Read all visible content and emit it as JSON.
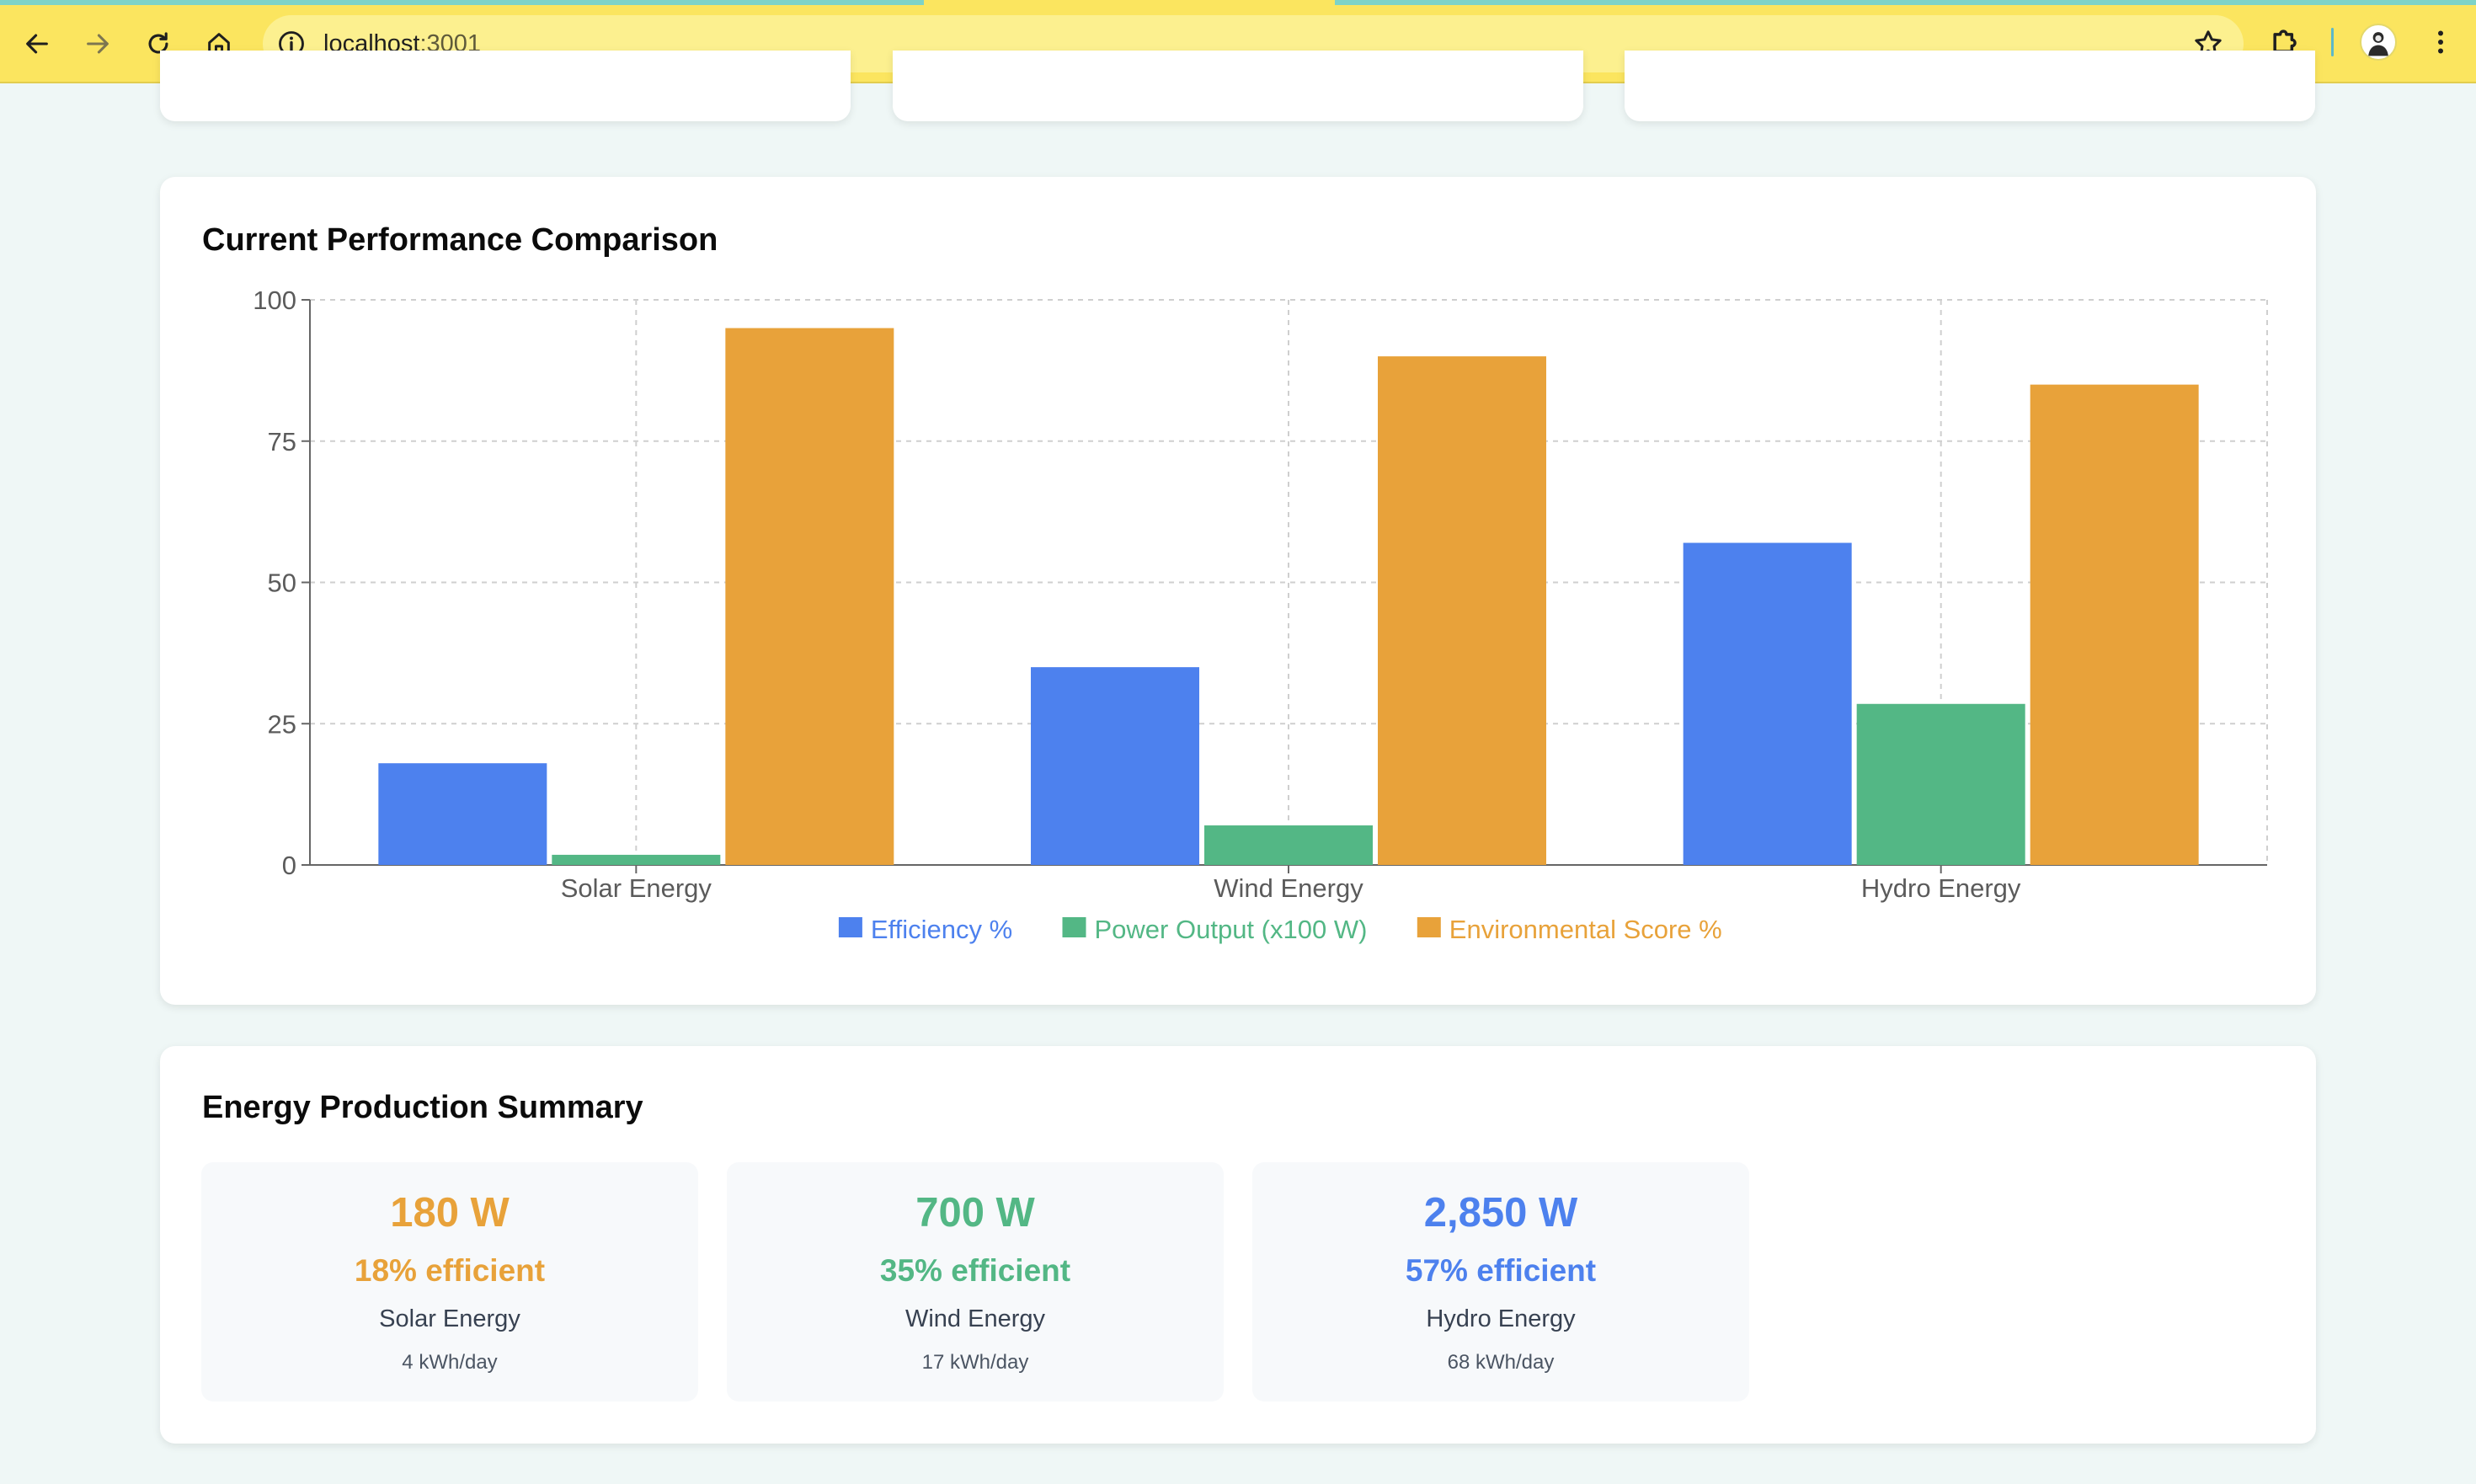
{
  "browser": {
    "url_host": "localhost",
    "url_port": ":3001"
  },
  "comparison": {
    "title": "Current Performance Comparison"
  },
  "chart_data": {
    "type": "bar",
    "categories": [
      "Solar Energy",
      "Wind Energy",
      "Hydro Energy"
    ],
    "series": [
      {
        "name": "Efficiency %",
        "values": [
          18,
          35,
          57
        ],
        "color": "#4d81ee"
      },
      {
        "name": "Power Output (x100 W)",
        "values": [
          1.8,
          7,
          28.5
        ],
        "color": "#53b785"
      },
      {
        "name": "Environmental Score %",
        "values": [
          95,
          90,
          85
        ],
        "color": "#e8a23a"
      }
    ],
    "y_ticks": [
      "0",
      "25",
      "50",
      "75",
      "100"
    ],
    "ylim": [
      0,
      100
    ],
    "grid": true,
    "legend": "bottom-center"
  },
  "summary": {
    "title": "Energy Production Summary",
    "items": [
      {
        "power": "180 W",
        "efficiency": "18% efficient",
        "name": "Solar Energy",
        "daily": "4 kWh/day",
        "color": "#e8a23a"
      },
      {
        "power": "700 W",
        "efficiency": "35% efficient",
        "name": "Wind Energy",
        "daily": "17 kWh/day",
        "color": "#53b785"
      },
      {
        "power": "2,850 W",
        "efficiency": "57% efficient",
        "name": "Hydro Energy",
        "daily": "68 kWh/day",
        "color": "#4d81ee"
      }
    ]
  }
}
